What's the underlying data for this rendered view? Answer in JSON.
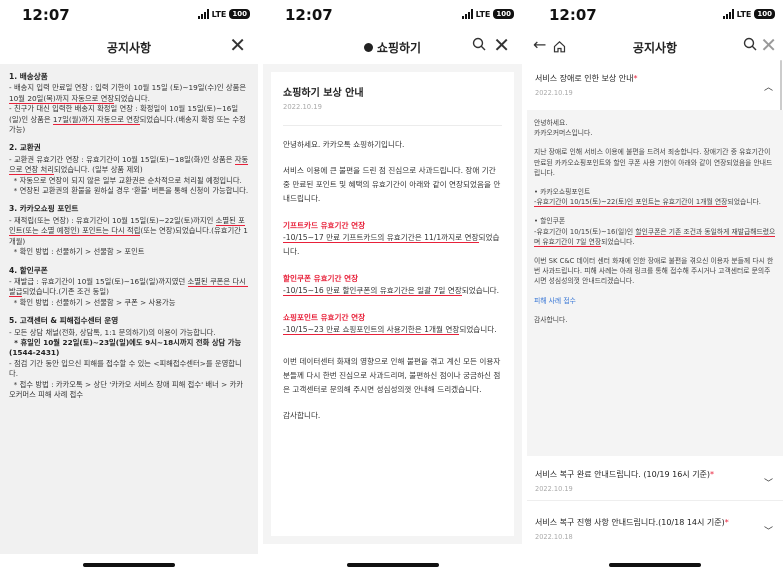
{
  "status": {
    "time": "12:07",
    "network": "LTE",
    "battery": "100"
  },
  "screen1": {
    "title": "공지사항",
    "sections": [
      {
        "title": "1. 배송상품",
        "lines": [
          [
            "- 배송지 입력 만료일 연장 : 입력 기한이 10월 15일 (토)~19일(수)인 상품은 ",
            {
              "u": "10월 20일(목)까지 자동으로 연장"
            },
            "되었습니다."
          ],
          [
            "- 친구가 대신 입력한 배송지 확정일 연장 : 확정일이 10월 15일(토)~16일(일)인 상품은 ",
            {
              "u": "17일(월)까지 자동으로 연장"
            },
            "되었습니다.(배송지 확정 또는 수정 가능)"
          ]
        ]
      },
      {
        "title": "2. 교환권",
        "lines": [
          [
            "- 교환권 유효기간 연장 : 유효기간이 10월 15일(토)~18일(화)인 상품은 ",
            {
              "u": "자동으로 연장 처리"
            },
            "되었습니다. (일부 상품 제외)"
          ],
          [
            "  * 자동으로 연장이 되지 않은 일부 교환권은 순차적으로 처리될 예정입니다."
          ],
          [
            "  * 연장된 교환권의 환불을 원하실 경우 '환불' 버튼을 통해 신청이 가능합니다."
          ]
        ]
      },
      {
        "title": "3. 카카오쇼핑 포인트",
        "lines": [
          [
            "- 재적립(또는 연장) : 유효기간이 10월 15일(토)~22일(토)까지인 ",
            {
              "u": "소멸된 포인트(또는 소멸 예정인) 포인트는 다시 적립"
            },
            "(또는 연장)되었습니다.(유효기간 1개월)"
          ],
          [
            "  * 확인 방법 : 선물하기 > 선물함 > 포인트"
          ]
        ]
      },
      {
        "title": "4. 할인쿠폰",
        "lines": [
          [
            "- 재발급 : 유효기간이 10월 15일(토)~16일(일)까지였던 ",
            {
              "u": "소멸된 쿠폰은 다시 발급"
            },
            "되었습니다.(기존 조건 동일)"
          ],
          [
            "  * 확인 방법 : 선물하기 > 선물함 > 쿠폰 > 사용가능"
          ]
        ]
      },
      {
        "title": "5. 고객센터 & 피해접수센터 운영",
        "lines": [
          [
            "- 모든 상담 채널(전화, 상담톡, 1:1 문의하기)의 이용이 가능합니다."
          ],
          [
            {
              "b": "  * 휴일인 10월 22일(토)~23일(일)에도 9시~18시까지 전화 상담 가능(1544-2431)"
            }
          ],
          [
            "- 점검 기간 동안 입으신 피해를 접수할 수 있는 <피해접수센터>를 운영합니다."
          ],
          [
            "  * 접수 방법 : 카카오톡 > 상단 '카카오 서비스 장애 피해 접수' 배너 > 카카오커머스 피해 사례 접수"
          ]
        ]
      }
    ]
  },
  "screen2": {
    "title": "쇼핑하기",
    "post_title": "쇼핑하기 보상 안내",
    "date": "2022.10.19",
    "greeting": "안녕하세요. 카카오톡 쇼핑하기입니다.",
    "intro": "서비스 이용에 큰 불편을 드린 점 진심으로 사과드립니다. 장애 기간 중 만료된 포인트 및 혜택의 유효기간이 아래와 같이 연장되었음을 안내드립니다.",
    "items": [
      {
        "heading": "기프트카드 유효기간 연장",
        "underlined": "-10/15~17 만료 기프트카드의 유효기간은 11/1까지로 연장",
        "tail": "되었습니다."
      },
      {
        "heading": "할인쿠폰 유효기간 연장",
        "underlined": "-10/15~16 만료 할인쿠폰의 유효기간은 일괄 7일 연장",
        "tail": "되었습니다."
      },
      {
        "heading": "쇼핑포인트 유효기간 연장",
        "underlined": "-10/15~23 만료 쇼핑포인트의 사용기한은 1개월 연장",
        "tail": "되었습니다."
      }
    ],
    "closing": "이번 데이터센터 화재의 영향으로 인해 불편을 겪고 계신 모든 이용자분들께 다시 한번 진심으로 사과드리며, 불편하신 점이나 궁금하신 점은 고객센터로 문의해 주시면 성심성의껏 안내해 드리겠습니다.",
    "thanks": "감사합니다."
  },
  "screen3": {
    "title": "공지사항",
    "open_item": {
      "title": "서비스 장애로 인한 보상 안내",
      "date": "2022.10.19"
    },
    "body": {
      "greeting": "안녕하세요.\n카카오커머스입니다.",
      "intro": "지난 장애로 인해 서비스 이용에 불편을 드려서 죄송합니다. 장애기간 중 유효기간이 만료된 카카오쇼핑포인트와 할인 쿠폰 사용 기한이 아래와 같이 연장되었음을 안내드립니다.",
      "point_head": "• 카카오쇼핑포인트",
      "point_u": "-유효기간이 10/15(토)~22(토)인 포인트는 유효기간이 1개월 연장",
      "point_tail": "되었습니다.",
      "coupon_head": "• 할인쿠폰",
      "coupon_pre": "-유효기간이 10/15(토)~16(일)인 ",
      "coupon_u": "할인쿠폰은 기존 조건과 동일하게 재발급해드렸으며 유효기간이 7일 연장",
      "coupon_tail": "되었습니다.",
      "closing": "이번 SK C&C 데이터 센터 화재에 인한 장애로 불편을 겪으신 이용자 분들께 다시 한 번 사과드립니다. 피해 사례는 아래 링크를 통해 접수해 주시거나 고객센터로 문의주시면 성심성의껏 안내드리겠습니다.",
      "link": "피해 사례 접수",
      "thanks": "감사합니다."
    },
    "items": [
      {
        "title": "서비스 복구 완료 안내드립니다. (10/19 16시 기준)",
        "date": "2022.10.19"
      },
      {
        "title": "서비스 복구 진행 사항 안내드립니다.(10/18 14시 기준)",
        "date": "2022.10.18"
      }
    ]
  },
  "colors": {
    "accent": "#e8213a",
    "link": "#3a78d6"
  }
}
